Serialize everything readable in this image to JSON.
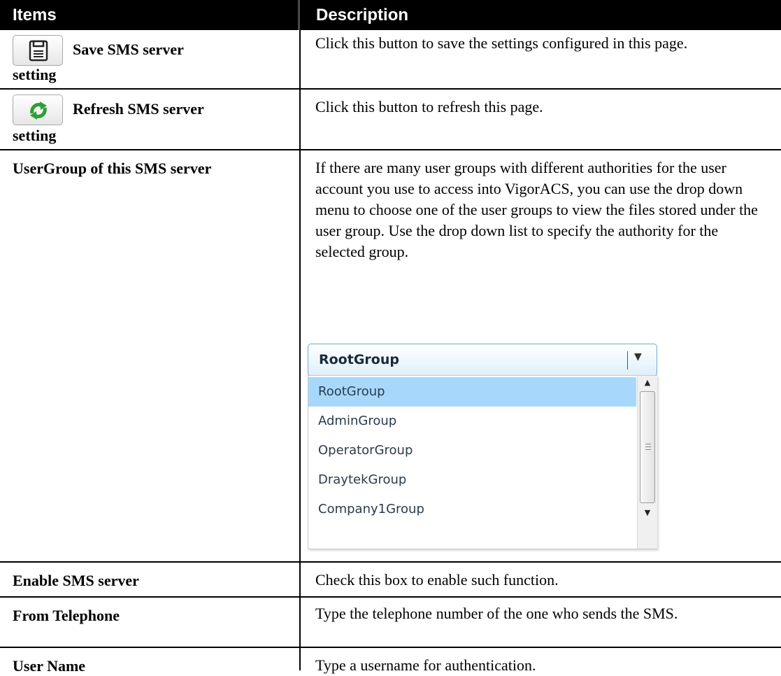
{
  "header": {
    "items": "Items",
    "description": "Description"
  },
  "rows": [
    {
      "item": "Save SMS server",
      "item_cont": "setting",
      "icon": "save-icon",
      "desc": "Click this button to save the settings configured in this page."
    },
    {
      "item": "Refresh SMS server",
      "item_cont": "setting",
      "icon": "refresh-icon",
      "desc": "Click this button to refresh this page."
    },
    {
      "item": "UserGroup of this SMS server",
      "desc": "If there are many user groups with different authorities for the user account you use to access into VigorACS, you can use the drop down menu to choose one of the user groups to view the files stored under the user group. Use the drop down list to specify the authority for the selected group."
    },
    {
      "item": "Enable SMS server",
      "desc": "Check this box to enable such function."
    },
    {
      "item": "From Telephone",
      "desc": "Type the telephone number of the one who sends the SMS."
    },
    {
      "item": "User Name",
      "desc": "Type a username for authentication."
    }
  ],
  "dropdown": {
    "selected": "RootGroup",
    "options": [
      "RootGroup",
      "AdminGroup",
      "OperatorGroup",
      "DraytekGroup",
      "Company1Group"
    ],
    "highlight_color": "#a7d8fb"
  }
}
